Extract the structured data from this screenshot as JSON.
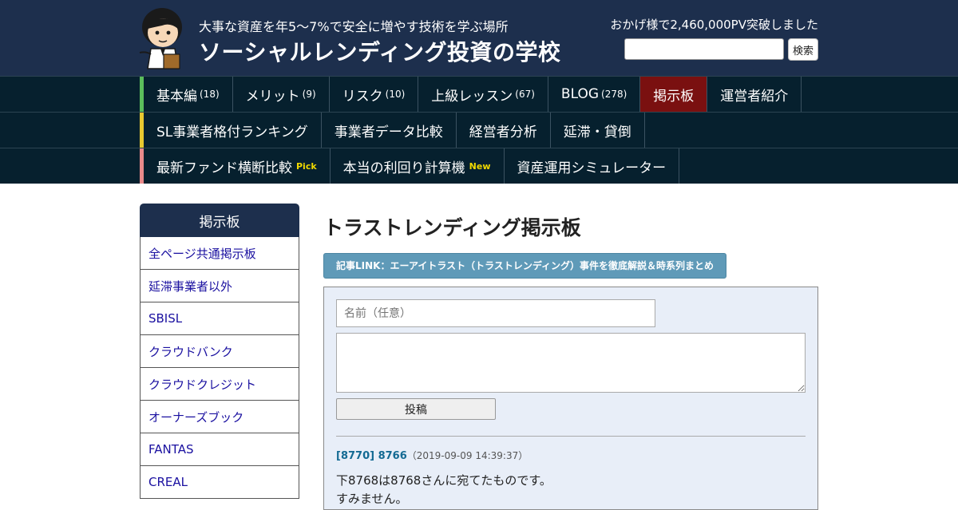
{
  "header": {
    "tagline": "大事な資産を年5～7%で安全に増やす技術を学ぶ場所",
    "site_title": "ソーシャルレンディング投資の学校",
    "pv_text": "おかげ様で2,460,000PV突破しました",
    "search_button": "検索"
  },
  "nav": {
    "rows": [
      {
        "accent": "#5bbd5b",
        "items": [
          {
            "label": "基本編",
            "count": "(18)"
          },
          {
            "label": "メリット",
            "count": "(9)"
          },
          {
            "label": "リスク",
            "count": "(10)"
          },
          {
            "label": "上級レッスン",
            "count": "(67)"
          },
          {
            "label": "BLOG",
            "count": "(278)"
          },
          {
            "label": "掲示板",
            "active": true
          },
          {
            "label": "運営者紹介"
          }
        ]
      },
      {
        "accent": "#e8c830",
        "items": [
          {
            "label": "SL事業者格付ランキング"
          },
          {
            "label": "事業者データ比較"
          },
          {
            "label": "経営者分析"
          },
          {
            "label": "延滞・貸倒"
          }
        ]
      },
      {
        "accent": "#e88a8a",
        "items": [
          {
            "label": "最新ファンド横断比較",
            "badge": "Pick"
          },
          {
            "label": "本当の利回り計算機",
            "badge": "New"
          },
          {
            "label": "資産運用シミュレーター"
          }
        ]
      }
    ]
  },
  "sidebar": {
    "title": "掲示板",
    "items": [
      "全ページ共通掲示板",
      "延滞事業者以外",
      "SBISL",
      "クラウドバンク",
      "クラウドクレジット",
      "オーナーズブック",
      "FANTAS",
      "CREAL"
    ]
  },
  "main": {
    "title": "トラストレンディング掲示板",
    "article_link": "記事LINK：エーアイトラスト（トラストレンディング）事件を徹底解説＆時系列まとめ",
    "form": {
      "name_placeholder": "名前（任意）",
      "post_button": "投稿"
    },
    "posts": [
      {
        "id": "[8770] 8766",
        "date": "（2019-09-09 14:39:37）",
        "lines": [
          "下8768は8768さんに宛てたものです。",
          "すみません。"
        ]
      }
    ]
  }
}
